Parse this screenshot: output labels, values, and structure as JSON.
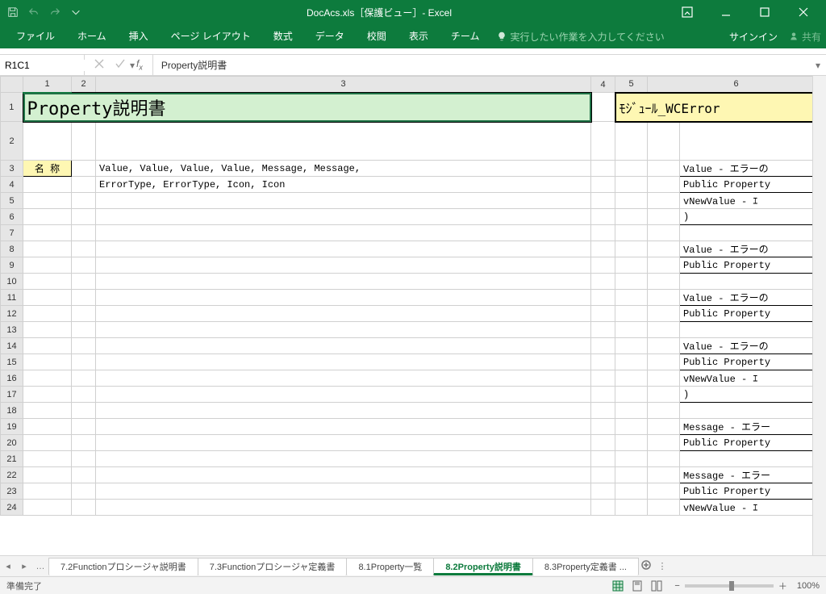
{
  "titlebar": {
    "title": "DocAcs.xls［保護ビュー］- Excel"
  },
  "ribbon": {
    "tabs": [
      "ファイル",
      "ホーム",
      "挿入",
      "ページ レイアウト",
      "数式",
      "データ",
      "校閲",
      "表示",
      "チーム"
    ],
    "tell_me": "実行したい作業を入力してください",
    "signin": "サインイン",
    "share": "共有"
  },
  "namebox": {
    "value": "R1C1"
  },
  "formula": {
    "value": "Property説明書"
  },
  "columns": [
    "",
    "1",
    "2",
    "3",
    "4",
    "5",
    "6"
  ],
  "row_numbers": [
    "1",
    "2",
    "3",
    "4",
    "5",
    "6",
    "7",
    "8",
    "9",
    "10",
    "11",
    "12",
    "13",
    "14",
    "15",
    "16",
    "17",
    "18",
    "19",
    "20",
    "21",
    "22",
    "23",
    "24"
  ],
  "cells": {
    "title_main": "Property説明書",
    "title_module": "ﾓｼﾞｭｰﾙ_WCError",
    "label_name": "名 称",
    "r3_c3": "Value, Value, Value, Value, Message, Message,",
    "r4_c3": "ErrorType, ErrorType, Icon, Icon",
    "right": {
      "r3": "Value - エラーの",
      "r4": "Public Property",
      "r5": "  vNewValue  - ｴ",
      "r6": ")",
      "r8": "Value - エラーの",
      "r9": "Public Property",
      "r11": "Value - エラーの",
      "r12": "Public Property",
      "r14": "Value - エラーの",
      "r15": "Public Property",
      "r16": "  vNewValue  - ｴ",
      "r17": ")",
      "r19": "Message - エラー",
      "r20": "Public Property",
      "r22": "Message - エラー",
      "r23": "Public Property",
      "r24": "  vNewValue  - ｴ"
    }
  },
  "sheet_tabs": {
    "items": [
      "7.2Functionプロシージャ説明書",
      "7.3Functionプロシージャ定義書",
      "8.1Property一覧",
      "8.2Property説明書",
      "8.3Property定義書 ..."
    ],
    "active_index": 3
  },
  "status": {
    "text": "準備完了",
    "zoom": "100%",
    "minus": "−",
    "plus": "＋"
  }
}
